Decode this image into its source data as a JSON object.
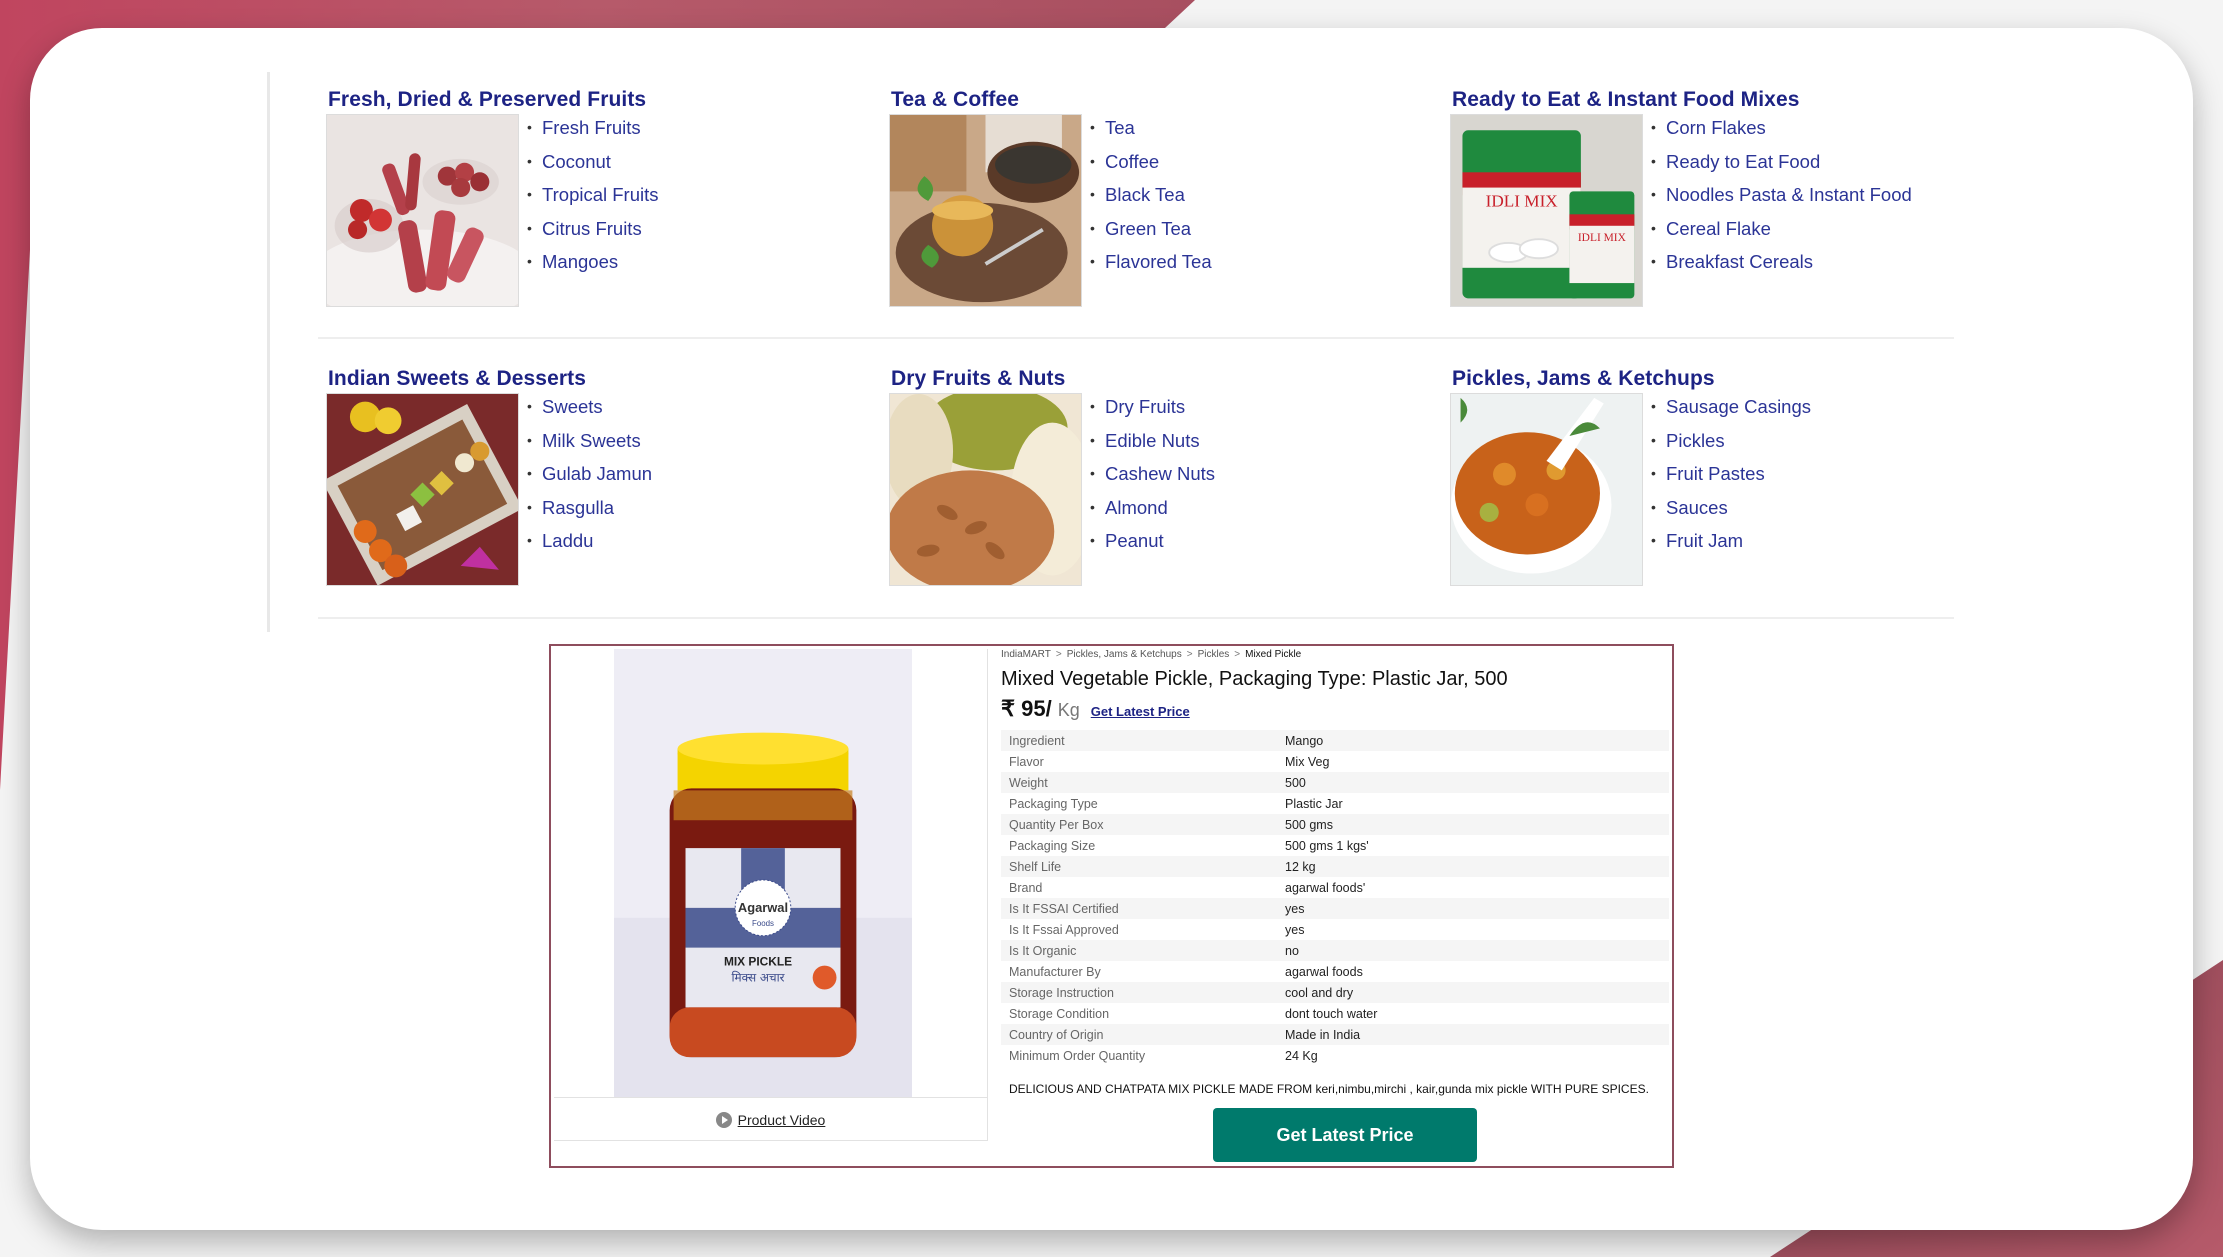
{
  "theme": {
    "accent": "#b85a6a",
    "category_title_color": "#1d2384",
    "link_color": "#2b3496",
    "cta_color": "#007a6c",
    "product_border": "#8e4d5d"
  },
  "categories": [
    {
      "title": "Fresh, Dried & Preserved Fruits",
      "image": "fruit-rolls-strawberries-image",
      "items": [
        "Fresh Fruits",
        "Coconut",
        "Tropical Fruits",
        "Citrus Fruits",
        "Mangoes"
      ]
    },
    {
      "title": "Tea & Coffee",
      "image": "tea-cup-image",
      "items": [
        "Tea",
        "Coffee",
        "Black Tea",
        "Green Tea",
        "Flavored Tea"
      ]
    },
    {
      "title": "Ready to Eat & Instant Food Mixes",
      "image": "idli-mix-packets-image",
      "items": [
        "Corn Flakes",
        "Ready to Eat Food",
        "Noodles Pasta & Instant Food",
        "Cereal Flake",
        "Breakfast Cereals"
      ]
    },
    {
      "title": "Indian Sweets & Desserts",
      "image": "sweets-tray-image",
      "items": [
        "Sweets",
        "Milk Sweets",
        "Gulab Jamun",
        "Rasgulla",
        "Laddu"
      ]
    },
    {
      "title": "Dry Fruits & Nuts",
      "image": "dry-fruits-image",
      "items": [
        "Dry Fruits",
        "Edible Nuts",
        "Cashew Nuts",
        "Almond",
        "Peanut"
      ]
    },
    {
      "title": "Pickles, Jams & Ketchups",
      "image": "pickle-bowl-image",
      "items": [
        "Sausage Casings",
        "Pickles",
        "Fruit Pastes",
        "Sauces",
        "Fruit Jam"
      ]
    }
  ],
  "product": {
    "breadcrumb": [
      "IndiaMART",
      "Pickles, Jams & Ketchups",
      "Pickles",
      "Mixed Pickle"
    ],
    "breadcrumb_separator": ">",
    "title": "Mixed Vegetable Pickle, Packaging Type: Plastic Jar, 500",
    "price": "₹ 95/",
    "unit": "Kg",
    "price_link": "Get Latest Price",
    "image_label_brand": "Agarwal",
    "image_label_sub": "Foods",
    "image_label_product": "MIX PICKLE",
    "image_label_hindi": "मिक्स अचार",
    "video_label": "Product Video",
    "specs": [
      {
        "key": "Ingredient",
        "value": "Mango"
      },
      {
        "key": "Flavor",
        "value": "Mix Veg"
      },
      {
        "key": "Weight",
        "value": "500"
      },
      {
        "key": "Packaging Type",
        "value": "Plastic Jar"
      },
      {
        "key": "Quantity Per Box",
        "value": "500 gms"
      },
      {
        "key": "Packaging Size",
        "value": "500 gms 1 kgs'"
      },
      {
        "key": "Shelf Life",
        "value": "12 kg"
      },
      {
        "key": "Brand",
        "value": "agarwal foods'"
      },
      {
        "key": "Is It FSSAI Certified",
        "value": "yes"
      },
      {
        "key": "Is It Fssai Approved",
        "value": "yes"
      },
      {
        "key": "Is It Organic",
        "value": "no"
      },
      {
        "key": "Manufacturer By",
        "value": "agarwal foods"
      },
      {
        "key": "Storage Instruction",
        "value": "cool and dry"
      },
      {
        "key": "Storage Condition",
        "value": "dont touch water"
      },
      {
        "key": "Country of Origin",
        "value": "Made in India"
      },
      {
        "key": "Minimum Order Quantity",
        "value": "24 Kg"
      }
    ],
    "description": "DELICIOUS AND CHATPATA MIX PICKLE MADE FROM keri,nimbu,mirchi , kair,gunda mix pickle WITH PURE SPICES.",
    "cta_label": "Get Latest Price"
  }
}
